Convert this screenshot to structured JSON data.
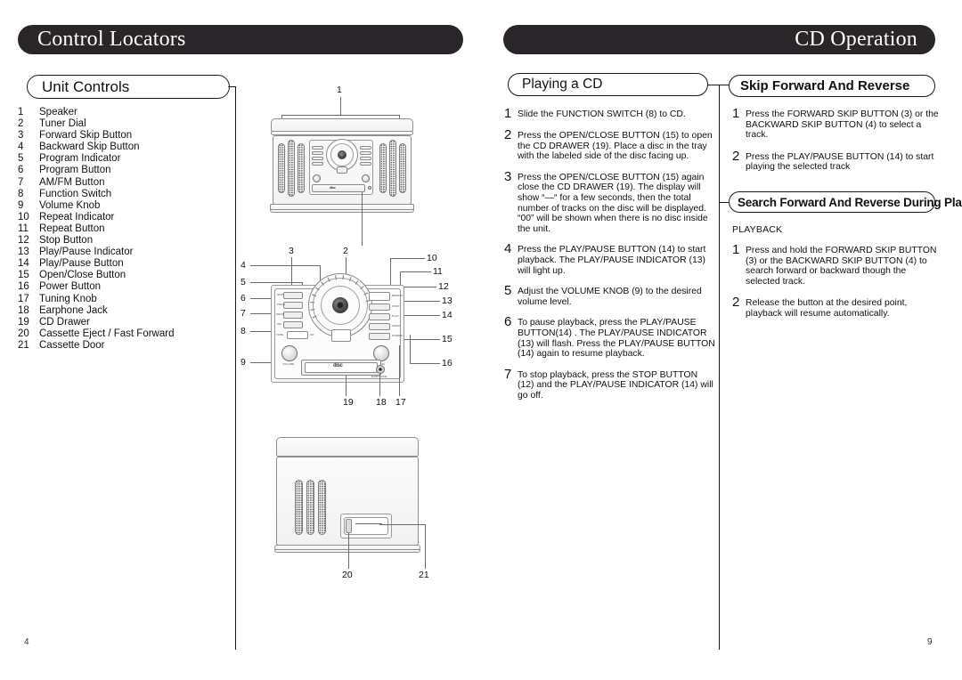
{
  "document": {
    "left_page": {
      "header_title": "Control Locators",
      "page_number": "4",
      "section_pill": "Unit Controls",
      "controls": [
        {
          "num": "1",
          "label": "Speaker"
        },
        {
          "num": "2",
          "label": "Tuner Dial"
        },
        {
          "num": "3",
          "label": "Forward Skip Button"
        },
        {
          "num": "4",
          "label": "Backward Skip Button"
        },
        {
          "num": "5",
          "label": "Program Indicator"
        },
        {
          "num": "6",
          "label": "Program Button"
        },
        {
          "num": "7",
          "label": "AM/FM Button"
        },
        {
          "num": "8",
          "label": "Function Switch"
        },
        {
          "num": "9",
          "label": "Volume Knob"
        },
        {
          "num": "10",
          "label": "Repeat Indicator"
        },
        {
          "num": "11",
          "label": "Repeat Button"
        },
        {
          "num": "12",
          "label": "Stop Button"
        },
        {
          "num": "13",
          "label": "Play/Pause Indicator"
        },
        {
          "num": "14",
          "label": "Play/Pause Button"
        },
        {
          "num": "15",
          "label": "Open/Close Button"
        },
        {
          "num": "16",
          "label": "Power Button"
        },
        {
          "num": "17",
          "label": "Tuning Knob"
        },
        {
          "num": "18",
          "label": "Earphone Jack"
        },
        {
          "num": "19",
          "label": "CD Drawer"
        },
        {
          "num": "20",
          "label": "Cassette Eject / Fast Forward"
        },
        {
          "num": "21",
          "label": "Cassette Door"
        }
      ],
      "diagrams": {
        "front_view_callouts": [
          "1"
        ],
        "panel_callouts": [
          "2",
          "3",
          "4",
          "5",
          "6",
          "7",
          "8",
          "9",
          "10",
          "11",
          "12",
          "13",
          "14",
          "15",
          "16",
          "17",
          "18",
          "19"
        ],
        "cassette_callouts": [
          "20",
          "21"
        ],
        "disc_logo": "disc",
        "knob_labels": {
          "volume": "VOLUME",
          "tuning": "TUNING",
          "earphone": "EARPHONE"
        }
      }
    },
    "right_page": {
      "header_title": "CD Operation",
      "header_title_caps": "CD",
      "header_title_rest": "Operation",
      "page_number": "9",
      "playing_a_cd": {
        "pill": "Playing a CD",
        "steps": [
          {
            "num": "1",
            "text": "Slide the FUNCTION SWITCH (8) to CD."
          },
          {
            "num": "2",
            "text": "Press the OPEN/CLOSE BUTTON (15) to open the CD DRAWER (19). Place a disc in the tray with the labeled side of the disc facing up."
          },
          {
            "num": "3",
            "text": "Press the OPEN/CLOSE BUTTON (15) again close the CD DRAWER (19). The display will show “—“ for a few seconds, then the total number of tracks on the disc will be displayed. “00” will be shown when there is no disc inside the unit."
          },
          {
            "num": "4",
            "text": "Press the PLAY/PAUSE BUTTON (14) to start playback. The PLAY/PAUSE INDICATOR (13) will light up."
          },
          {
            "num": "5",
            "text": "Adjust the VOLUME KNOB (9) to the desired volume level."
          },
          {
            "num": "6",
            "text": "To pause playback, press the PLAY/PAUSE BUTTON(14) . The PLAY/PAUSE INDICATOR (13) will flash. Press the PLAY/PAUSE BUTTON (14) again to resume playback."
          },
          {
            "num": "7",
            "text": "To stop playback, press the STOP BUTTON (12) and the PLAY/PAUSE INDICATOR (14) will go off."
          }
        ]
      },
      "skip_forward_and_reverse": {
        "pill": "Skip Forward And Reverse",
        "steps": [
          {
            "num": "1",
            "text": "Press the FORWARD SKIP BUTTON (3) or the BACKWARD SKIP BUTTON (4) to select a track."
          },
          {
            "num": "2",
            "text": "Press the PLAY/PAUSE BUTTON (14) to start playing the selected track"
          }
        ]
      },
      "search_forward_and_reverse": {
        "pill": "Search Forward And Reverse During Play",
        "subheading": "PLAYBACK",
        "steps": [
          {
            "num": "1",
            "text": "Press and hold the FORWARD SKIP BUTTON (3) or the BACKWARD SKIP BUTTON (4) to search forward or backward though the selected track."
          },
          {
            "num": "2",
            "text": "Release the button at the desired point, playback will resume automatically."
          }
        ]
      }
    },
    "colors": {
      "header_bar": "#2a2528",
      "header_text": "#ffffff",
      "body_text": "#111111",
      "line": "#6b6b6b",
      "page_bg": "#ffffff"
    }
  }
}
